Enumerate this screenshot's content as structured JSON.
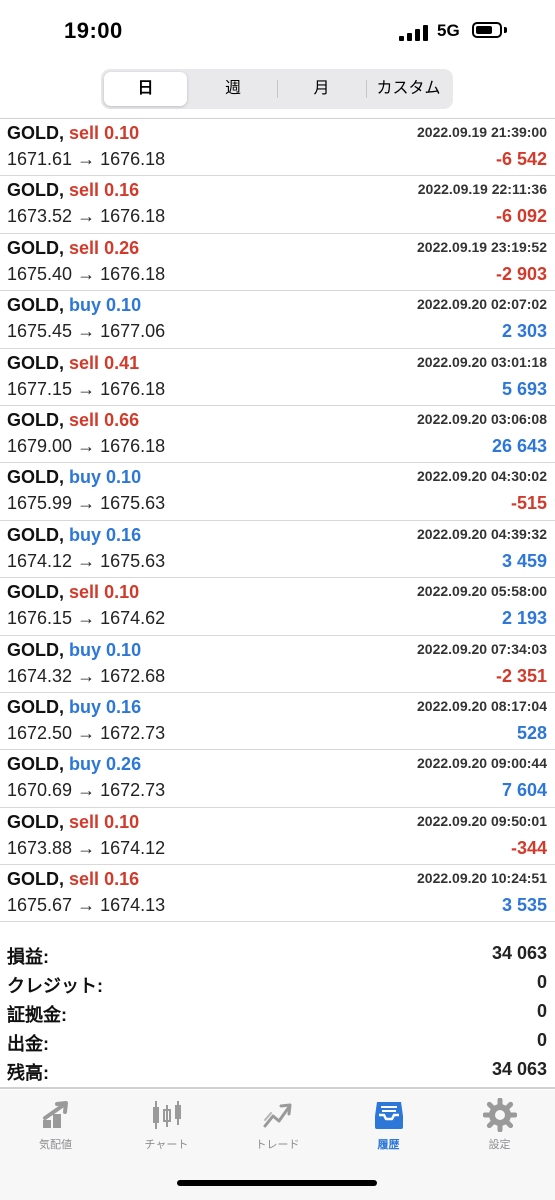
{
  "status": {
    "time": "19:00",
    "network": "5G"
  },
  "period_tabs": [
    {
      "label": "日",
      "active": true
    },
    {
      "label": "週",
      "active": false
    },
    {
      "label": "月",
      "active": false
    },
    {
      "label": "カスタム",
      "active": false
    }
  ],
  "trades": [
    {
      "symbol": "GOLD,",
      "side": "sell",
      "volume": "0.10",
      "datetime": "2022.09.19 21:39:00",
      "prices": "1671.61 → 1676.18",
      "profit": "-6 542"
    },
    {
      "symbol": "GOLD,",
      "side": "sell",
      "volume": "0.16",
      "datetime": "2022.09.19 22:11:36",
      "prices": "1673.52 → 1676.18",
      "profit": "-6 092"
    },
    {
      "symbol": "GOLD,",
      "side": "sell",
      "volume": "0.26",
      "datetime": "2022.09.19 23:19:52",
      "prices": "1675.40 → 1676.18",
      "profit": "-2 903"
    },
    {
      "symbol": "GOLD,",
      "side": "buy",
      "volume": "0.10",
      "datetime": "2022.09.20 02:07:02",
      "prices": "1675.45 → 1677.06",
      "profit": "2 303"
    },
    {
      "symbol": "GOLD,",
      "side": "sell",
      "volume": "0.41",
      "datetime": "2022.09.20 03:01:18",
      "prices": "1677.15 → 1676.18",
      "profit": "5 693"
    },
    {
      "symbol": "GOLD,",
      "side": "sell",
      "volume": "0.66",
      "datetime": "2022.09.20 03:06:08",
      "prices": "1679.00 → 1676.18",
      "profit": "26 643"
    },
    {
      "symbol": "GOLD,",
      "side": "buy",
      "volume": "0.10",
      "datetime": "2022.09.20 04:30:02",
      "prices": "1675.99 → 1675.63",
      "profit": "-515"
    },
    {
      "symbol": "GOLD,",
      "side": "buy",
      "volume": "0.16",
      "datetime": "2022.09.20 04:39:32",
      "prices": "1674.12 → 1675.63",
      "profit": "3 459"
    },
    {
      "symbol": "GOLD,",
      "side": "sell",
      "volume": "0.10",
      "datetime": "2022.09.20 05:58:00",
      "prices": "1676.15 → 1674.62",
      "profit": "2 193"
    },
    {
      "symbol": "GOLD,",
      "side": "buy",
      "volume": "0.10",
      "datetime": "2022.09.20 07:34:03",
      "prices": "1674.32 → 1672.68",
      "profit": "-2 351"
    },
    {
      "symbol": "GOLD,",
      "side": "buy",
      "volume": "0.16",
      "datetime": "2022.09.20 08:17:04",
      "prices": "1672.50 → 1672.73",
      "profit": "528"
    },
    {
      "symbol": "GOLD,",
      "side": "buy",
      "volume": "0.26",
      "datetime": "2022.09.20 09:00:44",
      "prices": "1670.69 → 1672.73",
      "profit": "7 604"
    },
    {
      "symbol": "GOLD,",
      "side": "sell",
      "volume": "0.10",
      "datetime": "2022.09.20 09:50:01",
      "prices": "1673.88 → 1674.12",
      "profit": "-344"
    },
    {
      "symbol": "GOLD,",
      "side": "sell",
      "volume": "0.16",
      "datetime": "2022.09.20 10:24:51",
      "prices": "1675.67 → 1674.13",
      "profit": "3 535"
    }
  ],
  "summary": [
    {
      "label": "損益:",
      "value": "34 063"
    },
    {
      "label": "クレジット:",
      "value": "0"
    },
    {
      "label": "証拠金:",
      "value": "0"
    },
    {
      "label": "出金:",
      "value": "0"
    },
    {
      "label": "残高:",
      "value": "34 063"
    }
  ],
  "tabbar": [
    {
      "label": "気配値",
      "icon": "quotes-icon",
      "active": false
    },
    {
      "label": "チャート",
      "icon": "chart-icon",
      "active": false
    },
    {
      "label": "トレード",
      "icon": "trade-icon",
      "active": false
    },
    {
      "label": "履歴",
      "icon": "history-icon",
      "active": true
    },
    {
      "label": "設定",
      "icon": "settings-icon",
      "active": false
    }
  ],
  "colors": {
    "sell": "#d23b2b",
    "buy": "#2d77d9",
    "negative": "#d23b2b",
    "positive": "#2d77d9",
    "active_tab": "#2d77d9",
    "inactive_tab": "#8e8e93"
  }
}
